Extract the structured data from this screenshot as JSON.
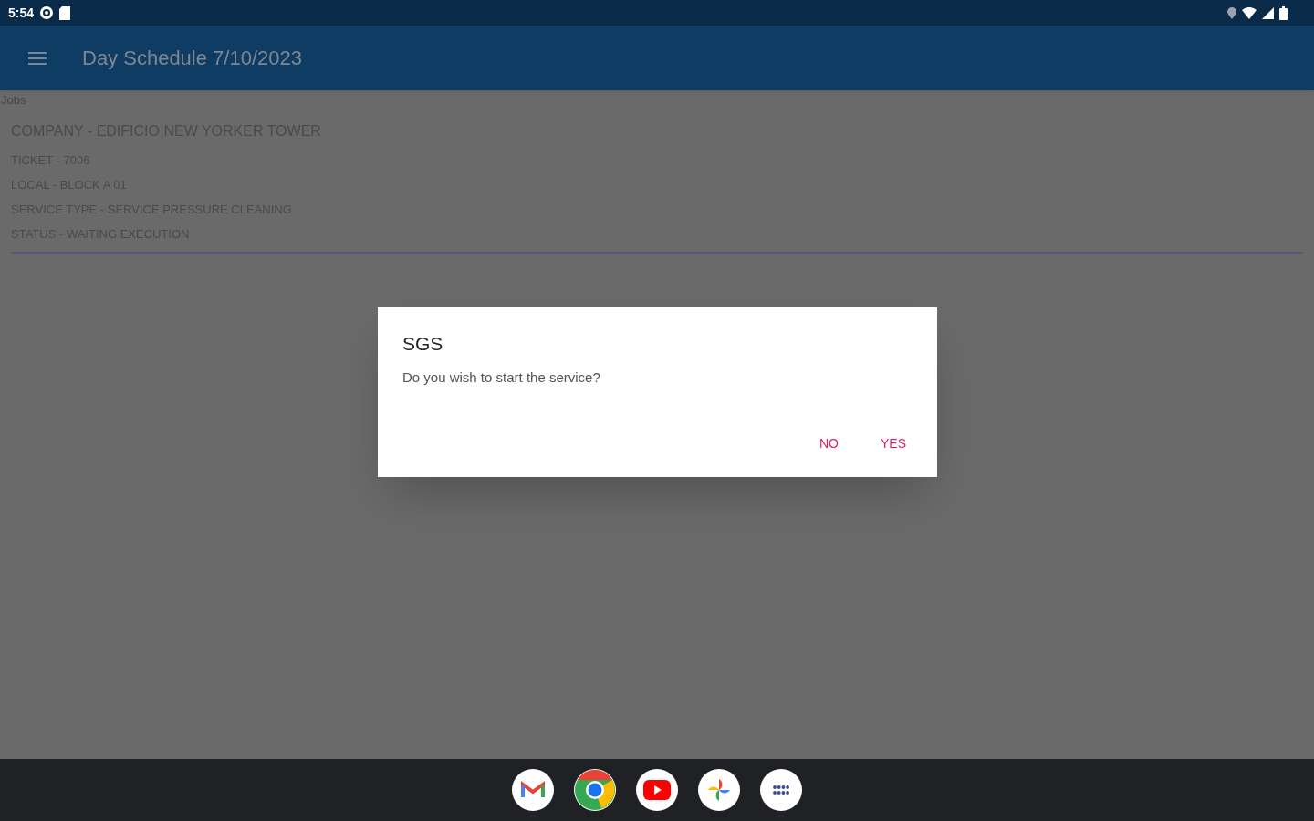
{
  "status_bar": {
    "time": "5:54"
  },
  "app_bar": {
    "title": "Day Schedule 7/10/2023"
  },
  "section_label": "Jobs",
  "jobs": [
    {
      "title": "COMPANY - EDIFICIO NEW YORKER TOWER",
      "lines": [
        "TICKET - 7006",
        "LOCAL - BLOCK A 01",
        "SERVICE TYPE - SERVICE PRESSURE CLEANING",
        "STATUS - WAITING EXECUTION"
      ]
    }
  ],
  "dialog": {
    "title": "SGS",
    "message": "Do you wish to start the service?",
    "buttons": [
      "NO",
      "YES"
    ]
  }
}
